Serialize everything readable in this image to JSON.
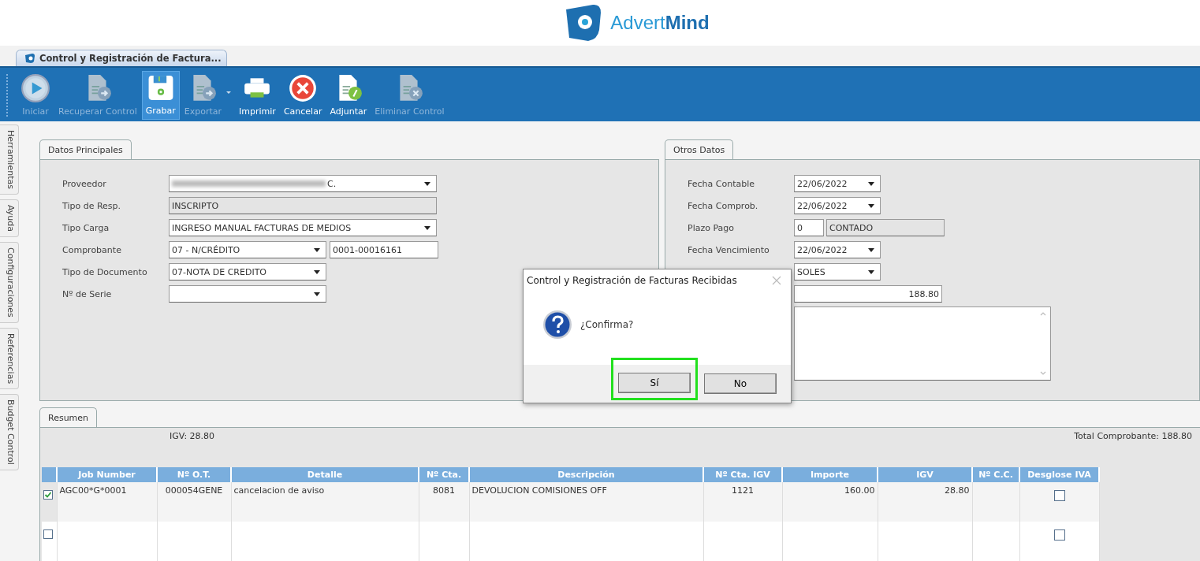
{
  "brand": {
    "name_light": "Advert",
    "name_bold": "Mind"
  },
  "document_tab": {
    "title": "Control y Registración de Factura..."
  },
  "toolbar": [
    {
      "label": "Iniciar",
      "kind": "play",
      "disabled": true,
      "selected": false,
      "dropdown": false
    },
    {
      "label": "Recuperar Control",
      "kind": "doc-return",
      "disabled": true,
      "selected": false,
      "dropdown": false
    },
    {
      "label": "Grabar",
      "kind": "floppy",
      "disabled": false,
      "selected": true,
      "dropdown": false
    },
    {
      "label": "Exportar",
      "kind": "doc-arrow",
      "disabled": true,
      "selected": false,
      "dropdown": true
    },
    {
      "label": "Imprimir",
      "kind": "printer",
      "disabled": false,
      "selected": false,
      "dropdown": false
    },
    {
      "label": "Cancelar",
      "kind": "cancel",
      "disabled": false,
      "selected": false,
      "dropdown": false
    },
    {
      "label": "Adjuntar",
      "kind": "doc-clip",
      "disabled": false,
      "selected": false,
      "dropdown": false
    },
    {
      "label": "Eliminar Control",
      "kind": "doc-x",
      "disabled": true,
      "selected": false,
      "dropdown": false
    }
  ],
  "side_tabs": [
    "Herramientas",
    "Ayuda",
    "Configuraciones",
    "Referencias",
    "Budget Control"
  ],
  "datos_principales": {
    "title": "Datos Principales",
    "fields": [
      {
        "label": "Proveedor",
        "kind": "combo",
        "value": "C.",
        "redacted": true
      },
      {
        "label": "Tipo de Resp.",
        "kind": "readonly",
        "value": "INSCRIPTO"
      },
      {
        "label": "Tipo Carga",
        "kind": "combo",
        "value": "INGRESO MANUAL FACTURAS DE MEDIOS"
      },
      {
        "label": "Comprobante",
        "kind": "combo-text",
        "value": "07 - N/CRÉDITO",
        "value2": "0001-00016161"
      },
      {
        "label": "Tipo de Documento",
        "kind": "short-combo",
        "value": "07-NOTA DE CREDITO"
      },
      {
        "label": "Nº de Serie",
        "kind": "short-combo"
      }
    ]
  },
  "otros_datos": {
    "title": "Otros Datos",
    "fields": [
      {
        "label": "Fecha Contable",
        "kind": "combo",
        "value": "22/06/2022"
      },
      {
        "label": "Fecha Comprob.",
        "kind": "combo",
        "value": "22/06/2022"
      },
      {
        "label": "Plazo Pago",
        "kind": "text-readonly",
        "value": "0",
        "value2": "CONTADO"
      },
      {
        "label": "Fecha Vencimiento",
        "kind": "combo",
        "value": "22/06/2022"
      },
      {
        "kind": "combo",
        "value": "SOLES"
      },
      {
        "kind": "amount",
        "value": "188.80"
      },
      {
        "kind": "memo"
      }
    ]
  },
  "resumen": {
    "title": "Resumen",
    "igv": "IGV: 28.80",
    "total": "Total Comprobante: 188.80",
    "columns": [
      "Job Number",
      "Nº O.T.",
      "Detalle",
      "Nº Cta.",
      "Descripción",
      "Nº Cta. IGV",
      "Importe",
      "IGV",
      "Nº C.C.",
      "Desglose IVA"
    ],
    "rows": [
      {
        "checked": true,
        "cells": [
          "AGC00*G*0001",
          "000054GENE",
          "cancelacion de aviso",
          "8081",
          "DEVOLUCION COMISIONES OFF",
          "1121",
          "160.00",
          "28.80",
          ""
        ],
        "desglose": false
      },
      {
        "checked": false,
        "cells": [
          "",
          "",
          "",
          "",
          "",
          "",
          "",
          "",
          ""
        ],
        "desglose": false
      }
    ]
  },
  "dialog": {
    "title": "Control y Registración de Facturas Recibidas",
    "message": "¿Confirma?",
    "buttons": [
      {
        "label": "Sí",
        "highlighted": true
      },
      {
        "label": "No",
        "highlighted": false
      }
    ]
  }
}
